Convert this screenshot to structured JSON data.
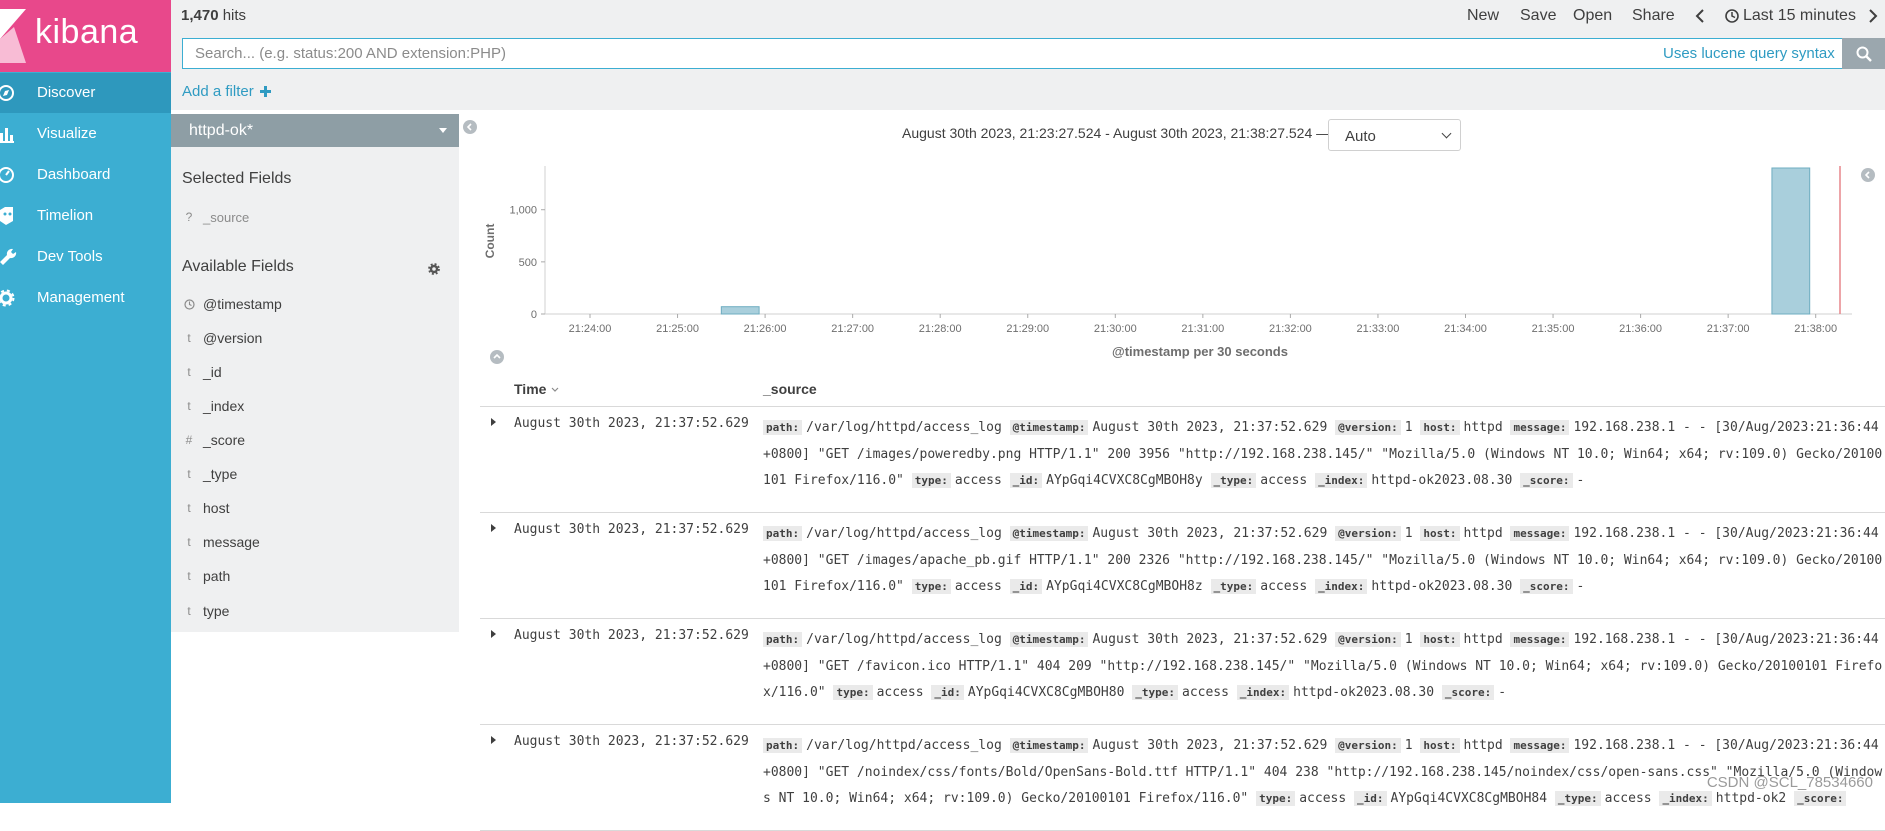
{
  "app": {
    "logo_text": "kibana"
  },
  "sidebar": {
    "items": [
      {
        "label": "Discover",
        "icon": "compass-icon"
      },
      {
        "label": "Visualize",
        "icon": "bar-chart-icon"
      },
      {
        "label": "Dashboard",
        "icon": "dashboard-icon"
      },
      {
        "label": "Timelion",
        "icon": "timelion-icon"
      },
      {
        "label": "Dev Tools",
        "icon": "wrench-icon"
      },
      {
        "label": "Management",
        "icon": "gear-icon"
      }
    ]
  },
  "header": {
    "hits_count": "1,470",
    "hits_label": "hits",
    "actions": {
      "new": "New",
      "save": "Save",
      "open": "Open",
      "share": "Share"
    },
    "time_picker": "Last 15 minutes"
  },
  "search": {
    "placeholder": "Search... (e.g. status:200 AND extension:PHP)",
    "value": "",
    "syntax_link": "Uses lucene query syntax"
  },
  "filter": {
    "add_label": "Add a filter"
  },
  "fields_panel": {
    "index_pattern": "httpd-ok*",
    "selected_heading": "Selected Fields",
    "selected_fields": [
      {
        "type": "?",
        "name": "_source"
      }
    ],
    "available_heading": "Available Fields",
    "available_fields": [
      {
        "type": "clock",
        "name": "@timestamp"
      },
      {
        "type": "t",
        "name": "@version"
      },
      {
        "type": "t",
        "name": "_id"
      },
      {
        "type": "t",
        "name": "_index"
      },
      {
        "type": "#",
        "name": "_score"
      },
      {
        "type": "t",
        "name": "_type"
      },
      {
        "type": "t",
        "name": "host"
      },
      {
        "type": "t",
        "name": "message"
      },
      {
        "type": "t",
        "name": "path"
      },
      {
        "type": "t",
        "name": "type"
      }
    ]
  },
  "histogram": {
    "time_range": "August 30th 2023, 21:23:27.524 - August 30th 2023, 21:38:27.524 —",
    "interval": "Auto"
  },
  "chart_data": {
    "type": "bar",
    "title": "",
    "xlabel": "@timestamp per 30 seconds",
    "ylabel": "Count",
    "x_ticks": [
      "21:24:00",
      "21:25:00",
      "21:26:00",
      "21:27:00",
      "21:28:00",
      "21:29:00",
      "21:30:00",
      "21:31:00",
      "21:32:00",
      "21:33:00",
      "21:34:00",
      "21:35:00",
      "21:36:00",
      "21:37:00",
      "21:38:00"
    ],
    "y_ticks": [
      "0",
      "500",
      "1,000"
    ],
    "ylim": [
      0,
      1400
    ],
    "bars": [
      {
        "x": "21:25:30",
        "value": 70
      },
      {
        "x": "21:37:30",
        "value": 1400
      }
    ]
  },
  "table": {
    "col_time": "Time",
    "col_source": "_source",
    "rows": [
      {
        "time": "August 30th 2023, 21:37:52.629",
        "fields": [
          {
            "k": "path:",
            "v": "/var/log/httpd/access_log"
          },
          {
            "k": "@timestamp:",
            "v": "August 30th 2023, 21:37:52.629"
          },
          {
            "k": "@version:",
            "v": "1"
          },
          {
            "k": "host:",
            "v": "httpd"
          },
          {
            "k": "message:",
            "v": "192.168.238.1 - - [30/Aug/2023:21:36:44 +0800] \"GET /images/poweredby.png HTTP/1.1\" 200 3956 \"http://192.168.238.145/\" \"Mozilla/5.0 (Windows NT 10.0; Win64; x64; rv:109.0) Gecko/20100101 Firefox/116.0\""
          },
          {
            "k": "type:",
            "v": "access"
          },
          {
            "k": "_id:",
            "v": "AYpGqi4CVXC8CgMBOH8y"
          },
          {
            "k": "_type:",
            "v": "access"
          },
          {
            "k": "_index:",
            "v": "httpd-ok2023.08.30"
          },
          {
            "k": "_score:",
            "v": "-"
          }
        ]
      },
      {
        "time": "August 30th 2023, 21:37:52.629",
        "fields": [
          {
            "k": "path:",
            "v": "/var/log/httpd/access_log"
          },
          {
            "k": "@timestamp:",
            "v": "August 30th 2023, 21:37:52.629"
          },
          {
            "k": "@version:",
            "v": "1"
          },
          {
            "k": "host:",
            "v": "httpd"
          },
          {
            "k": "message:",
            "v": "192.168.238.1 - - [30/Aug/2023:21:36:44 +0800] \"GET /images/apache_pb.gif HTTP/1.1\" 200 2326 \"http://192.168.238.145/\" \"Mozilla/5.0 (Windows NT 10.0; Win64; x64; rv:109.0) Gecko/20100101 Firefox/116.0\""
          },
          {
            "k": "type:",
            "v": "access"
          },
          {
            "k": "_id:",
            "v": "AYpGqi4CVXC8CgMBOH8z"
          },
          {
            "k": "_type:",
            "v": "access"
          },
          {
            "k": "_index:",
            "v": "httpd-ok2023.08.30"
          },
          {
            "k": "_score:",
            "v": "-"
          }
        ]
      },
      {
        "time": "August 30th 2023, 21:37:52.629",
        "fields": [
          {
            "k": "path:",
            "v": "/var/log/httpd/access_log"
          },
          {
            "k": "@timestamp:",
            "v": "August 30th 2023, 21:37:52.629"
          },
          {
            "k": "@version:",
            "v": "1"
          },
          {
            "k": "host:",
            "v": "httpd"
          },
          {
            "k": "message:",
            "v": "192.168.238.1 - - [30/Aug/2023:21:36:44 +0800] \"GET /favicon.ico HTTP/1.1\" 404 209 \"http://192.168.238.145/\" \"Mozilla/5.0 (Windows NT 10.0; Win64; x64; rv:109.0) Gecko/20100101 Firefox/116.0\""
          },
          {
            "k": "type:",
            "v": "access"
          },
          {
            "k": "_id:",
            "v": "AYpGqi4CVXC8CgMBOH80"
          },
          {
            "k": "_type:",
            "v": "access"
          },
          {
            "k": "_index:",
            "v": "httpd-ok2023.08.30"
          },
          {
            "k": "_score:",
            "v": "-"
          }
        ]
      },
      {
        "time": "August 30th 2023, 21:37:52.629",
        "fields": [
          {
            "k": "path:",
            "v": "/var/log/httpd/access_log"
          },
          {
            "k": "@timestamp:",
            "v": "August 30th 2023, 21:37:52.629"
          },
          {
            "k": "@version:",
            "v": "1"
          },
          {
            "k": "host:",
            "v": "httpd"
          },
          {
            "k": "message:",
            "v": "192.168.238.1 - - [30/Aug/2023:21:36:44 +0800] \"GET /noindex/css/fonts/Bold/OpenSans-Bold.ttf HTTP/1.1\" 404 238 \"http://192.168.238.145/noindex/css/open-sans.css\" \"Mozilla/5.0 (Windows NT 10.0; Win64; x64; rv:109.0) Gecko/20100101 Firefox/116.0\""
          },
          {
            "k": "type:",
            "v": "access"
          },
          {
            "k": "_id:",
            "v": "AYpGqi4CVXC8CgMBOH84"
          },
          {
            "k": "_type:",
            "v": "access"
          },
          {
            "k": "_index:",
            "v": "httpd-ok2"
          },
          {
            "k": "_score:",
            "v": ""
          }
        ]
      }
    ]
  },
  "watermark": "CSDN @SCL_78534660"
}
